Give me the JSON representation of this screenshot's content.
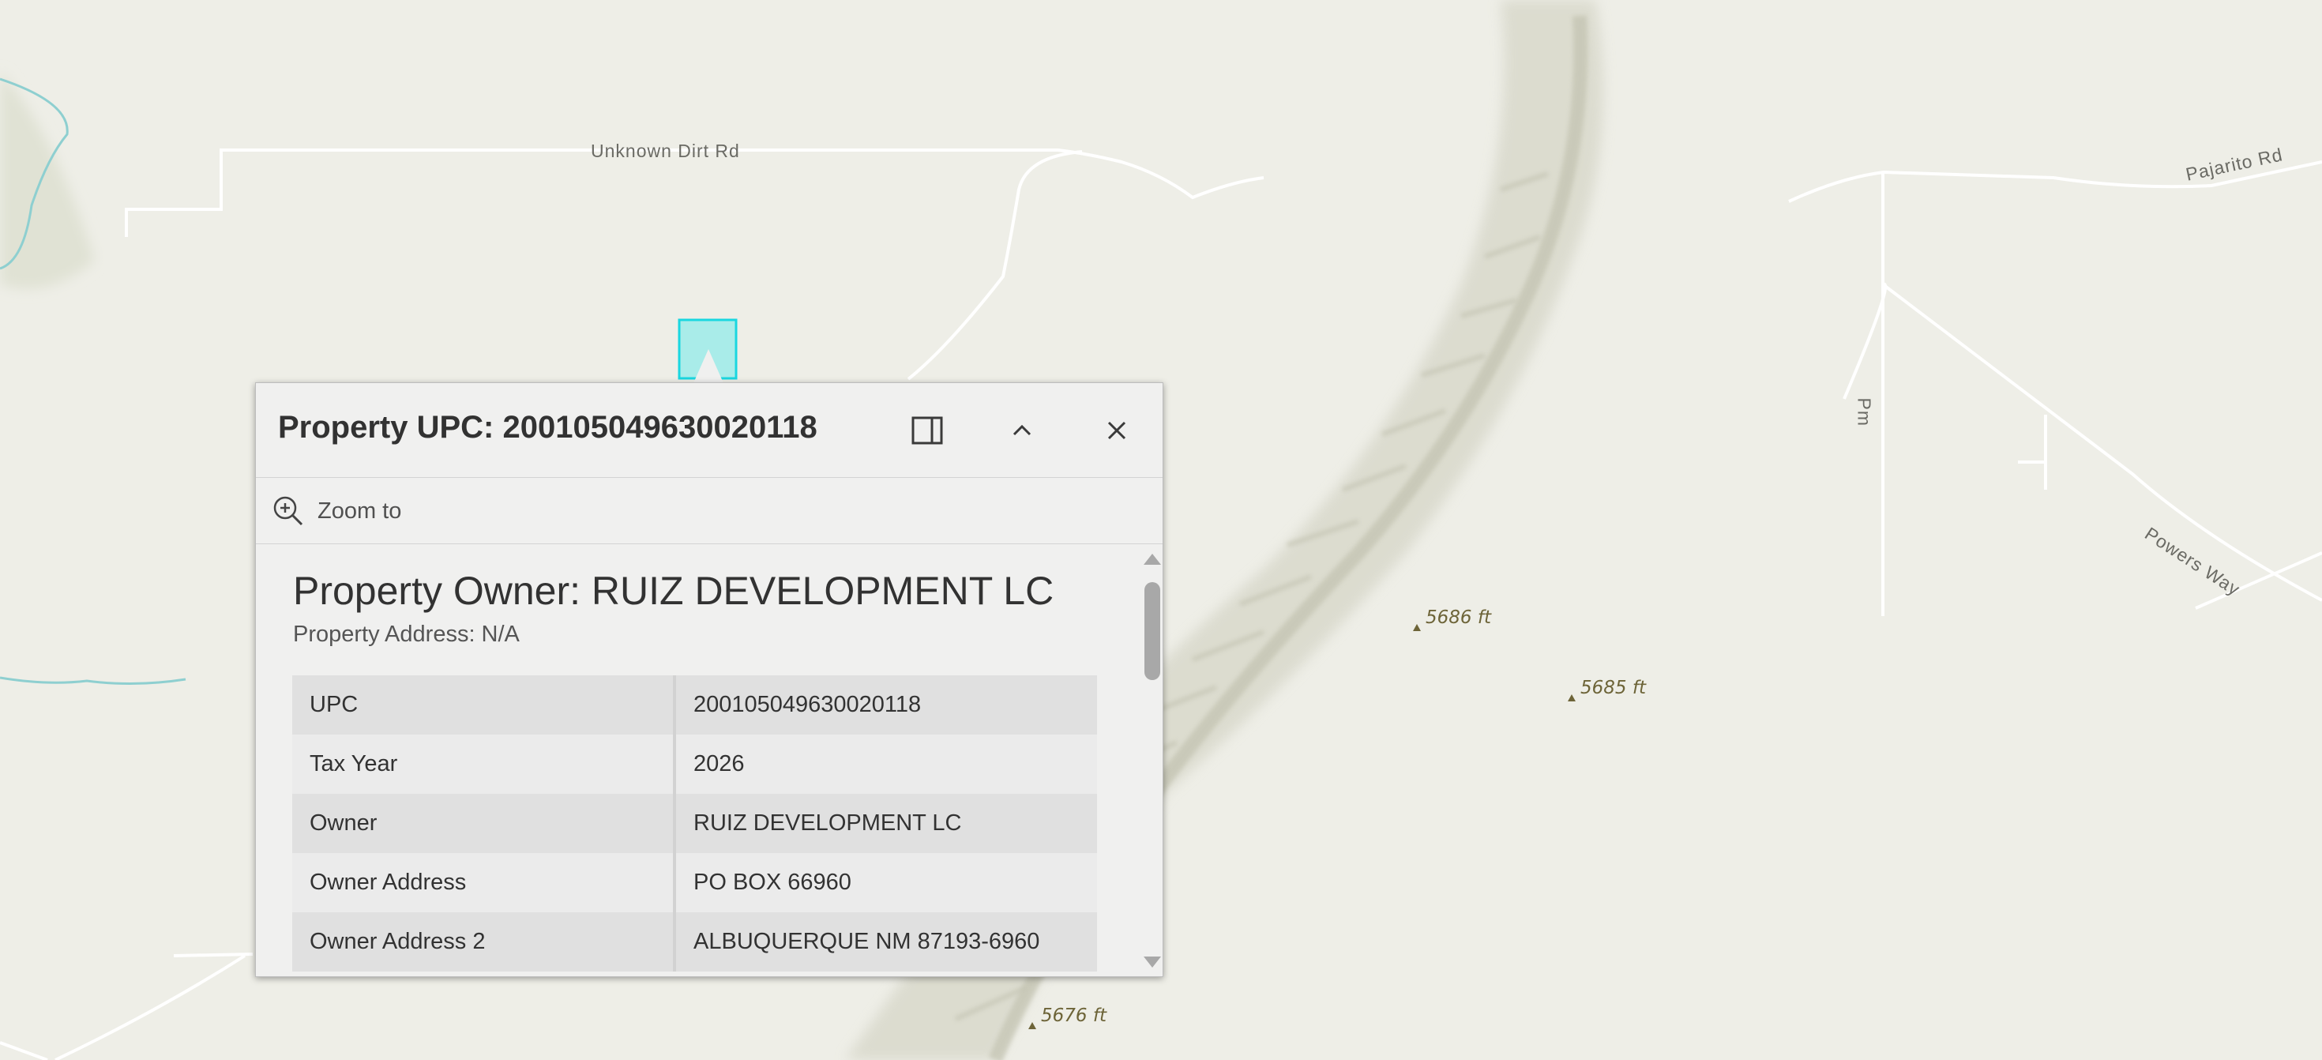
{
  "map": {
    "road_labels": {
      "unknown_dirt_rd": "Unknown Dirt Rd",
      "pajarito_rd": "Pajarito Rd",
      "pm": "Pm",
      "powers_way": "Powers Way"
    },
    "elevations": {
      "e1": "5686 ft",
      "e2": "5685 ft",
      "e3": "5676 ft"
    },
    "colors": {
      "land": "#eeeee7",
      "road": "#ffffff",
      "water": "#8ecfd0",
      "selected_parcel_fill": "#a9ece9",
      "selected_parcel_stroke": "#19d7e0"
    }
  },
  "popup": {
    "title": "Property UPC: 200105049630020118",
    "buttons": {
      "dock": "dock-icon",
      "collapse": "chevron-up-icon",
      "close": "close-icon"
    },
    "actions": {
      "zoom_to": "Zoom to",
      "zoom_icon": "zoom-in-icon"
    },
    "owner_heading": "Property Owner: RUIZ DEVELOPMENT LC",
    "address_line": "Property Address: N/A",
    "attributes": [
      {
        "key": "UPC",
        "value": "200105049630020118"
      },
      {
        "key": "Tax Year",
        "value": "2026"
      },
      {
        "key": "Owner",
        "value": "RUIZ DEVELOPMENT LC"
      },
      {
        "key": "Owner Address",
        "value": "PO BOX 66960"
      },
      {
        "key": "Owner Address 2",
        "value": "ALBUQUERQUE NM 87193-6960"
      }
    ]
  }
}
